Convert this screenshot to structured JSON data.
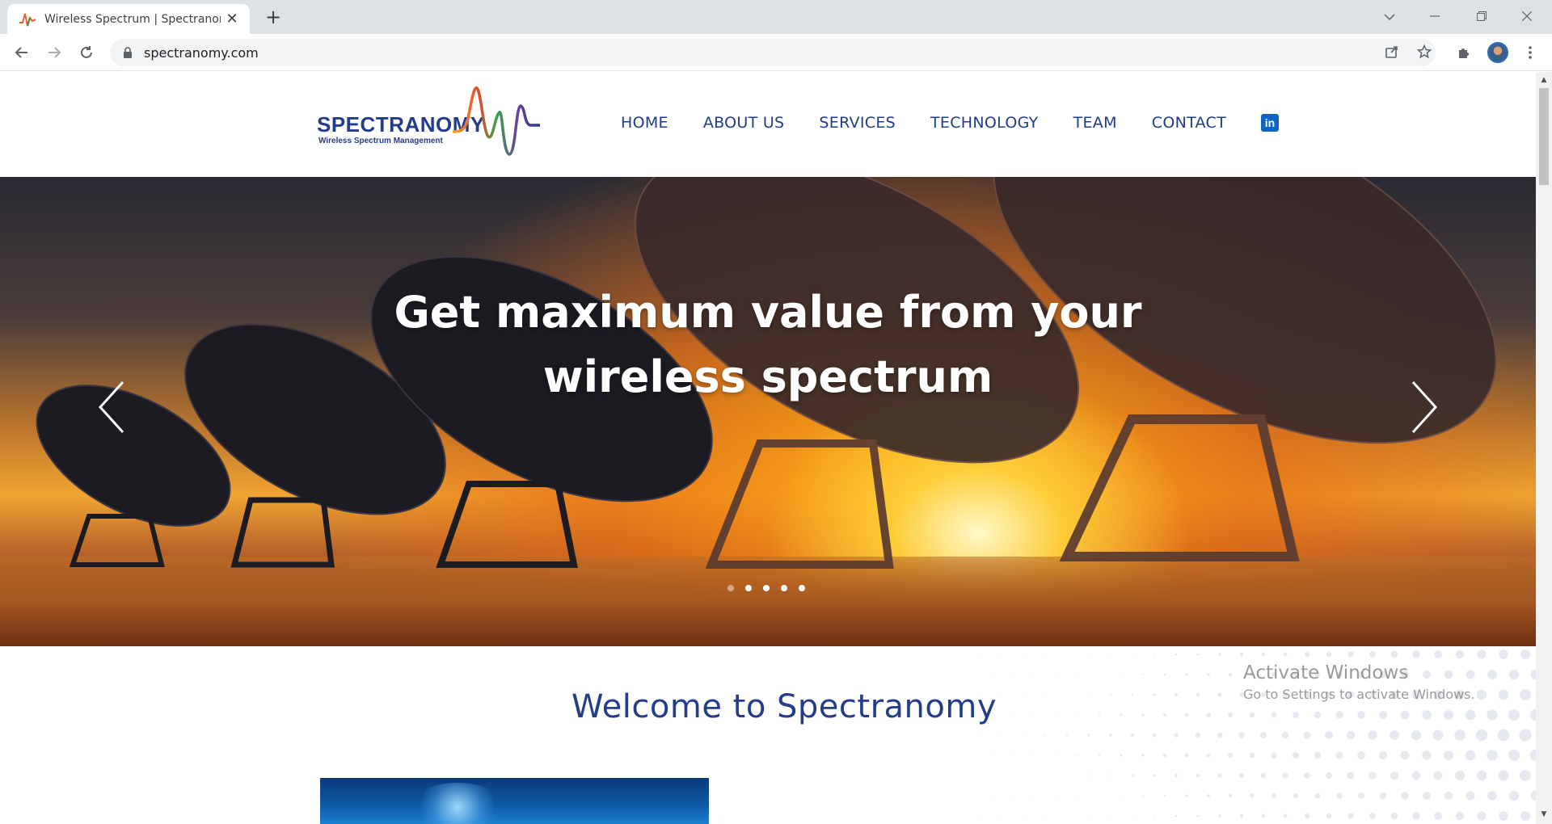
{
  "browser": {
    "tab_title": "Wireless Spectrum | Spectranomy",
    "new_tab_symbol": "+",
    "close_symbol": "✕",
    "url": "spectranomy.com"
  },
  "site": {
    "logo_name": "Spectranomy",
    "logo_tagline": "Wireless Spectrum Management",
    "nav": [
      {
        "label": "HOME"
      },
      {
        "label": "ABOUT US"
      },
      {
        "label": "SERVICES"
      },
      {
        "label": "TECHNOLOGY"
      },
      {
        "label": "TEAM"
      },
      {
        "label": "CONTACT"
      }
    ],
    "linkedin_glyph": "in"
  },
  "hero": {
    "heading_line1": "Get maximum value from your",
    "heading_line2": "wireless spectrum",
    "slide_count": 5,
    "active_slide": 1
  },
  "welcome": {
    "title": "Welcome to Spectranomy"
  },
  "watermark": {
    "line1": "Activate Windows",
    "line2": "Go to Settings to activate Windows."
  },
  "colors": {
    "brand_blue": "#233c8b",
    "nav_blue": "#1f3c88",
    "linkedin": "#0a66c2"
  }
}
